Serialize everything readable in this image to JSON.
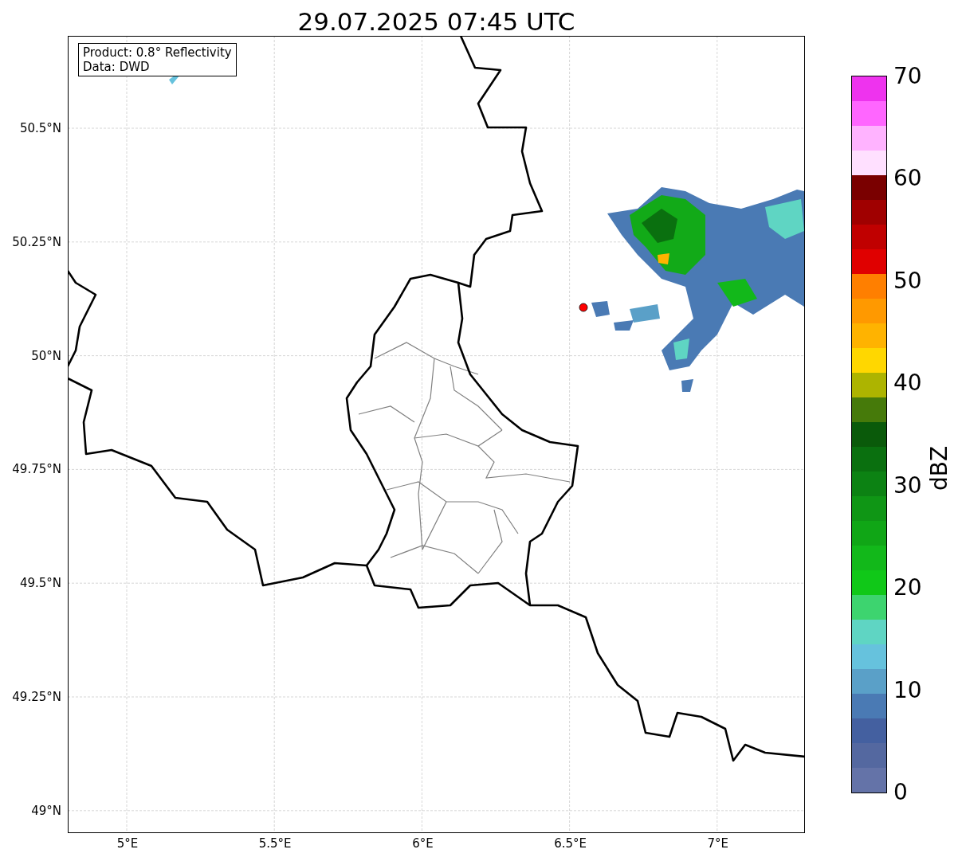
{
  "title": "29.07.2025 07:45 UTC",
  "info_box": [
    "Product: 0.8° Reflectivity",
    "Data: DWD"
  ],
  "y_ticks": [
    "50.5°N",
    "50.25°N",
    "50°N",
    "49.75°N",
    "49.5°N",
    "49.25°N",
    "49°N"
  ],
  "x_ticks": [
    "5°E",
    "5.5°E",
    "6°E",
    "6.5°E",
    "7°E"
  ],
  "colorbar": {
    "label": "dBZ",
    "ticks": [
      "70",
      "60",
      "50",
      "40",
      "30",
      "20",
      "10",
      "0"
    ],
    "segments": [
      {
        "color": "#6473a8"
      },
      {
        "color": "#5468a0"
      },
      {
        "color": "#4460a0"
      },
      {
        "color": "#4a7ab4"
      },
      {
        "color": "#5aa0c8"
      },
      {
        "color": "#66c2dd"
      },
      {
        "color": "#5fd5c3"
      },
      {
        "color": "#3dd46f"
      },
      {
        "color": "#10c818"
      },
      {
        "color": "#12b81a"
      },
      {
        "color": "#10a616"
      },
      {
        "color": "#0f9615"
      },
      {
        "color": "#0c8213"
      },
      {
        "color": "#0a700f"
      },
      {
        "color": "#0a5a0a"
      },
      {
        "color": "#467a0a"
      },
      {
        "color": "#adb400"
      },
      {
        "color": "#ffd700"
      },
      {
        "color": "#ffb300"
      },
      {
        "color": "#ff9900"
      },
      {
        "color": "#ff7f00"
      },
      {
        "color": "#e00000"
      },
      {
        "color": "#c00000"
      },
      {
        "color": "#a00000"
      },
      {
        "color": "#7a0000"
      },
      {
        "color": "#ffe0ff"
      },
      {
        "color": "#ffb3ff"
      },
      {
        "color": "#ff66ff"
      },
      {
        "color": "#ee33ee"
      }
    ]
  }
}
